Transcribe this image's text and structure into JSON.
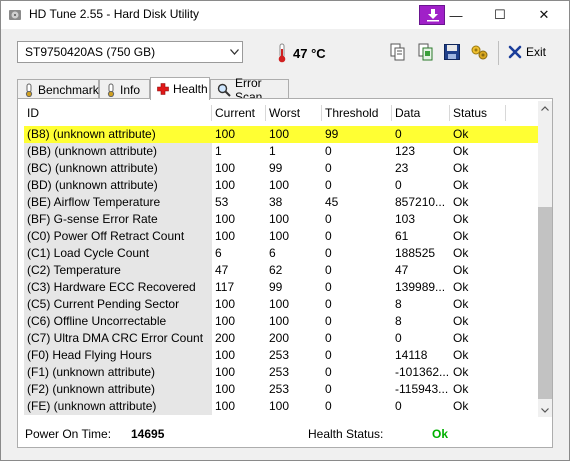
{
  "window": {
    "title": "HD Tune 2.55 - Hard Disk Utility",
    "minimize": "—",
    "maximize": "☐",
    "close": "✕"
  },
  "toolbar": {
    "drive": "ST9750420AS (750 GB)",
    "temperature": "47 °C",
    "exit_label": "Exit"
  },
  "tabs": [
    {
      "label": "Benchmark",
      "icon": "benchmark-icon"
    },
    {
      "label": "Info",
      "icon": "info-icon"
    },
    {
      "label": "Health",
      "icon": "health-icon",
      "active": true
    },
    {
      "label": "Error Scan",
      "icon": "error-scan-icon"
    }
  ],
  "table": {
    "columns": [
      "ID",
      "Current",
      "Worst",
      "Threshold",
      "Data",
      "Status"
    ],
    "rows": [
      [
        "(B8) (unknown attribute)",
        "100",
        "100",
        "99",
        "0",
        "Ok"
      ],
      [
        "(BB) (unknown attribute)",
        "1",
        "1",
        "0",
        "123",
        "Ok"
      ],
      [
        "(BC) (unknown attribute)",
        "100",
        "99",
        "0",
        "23",
        "Ok"
      ],
      [
        "(BD) (unknown attribute)",
        "100",
        "100",
        "0",
        "0",
        "Ok"
      ],
      [
        "(BE) Airflow Temperature",
        "53",
        "38",
        "45",
        "857210...",
        "Ok"
      ],
      [
        "(BF) G-sense Error Rate",
        "100",
        "100",
        "0",
        "103",
        "Ok"
      ],
      [
        "(C0) Power Off Retract Count",
        "100",
        "100",
        "0",
        "61",
        "Ok"
      ],
      [
        "(C1) Load Cycle Count",
        "6",
        "6",
        "0",
        "188525",
        "Ok"
      ],
      [
        "(C2) Temperature",
        "47",
        "62",
        "0",
        "47",
        "Ok"
      ],
      [
        "(C3) Hardware ECC Recovered",
        "117",
        "99",
        "0",
        "139989...",
        "Ok"
      ],
      [
        "(C5) Current Pending Sector",
        "100",
        "100",
        "0",
        "8",
        "Ok"
      ],
      [
        "(C6) Offline Uncorrectable",
        "100",
        "100",
        "0",
        "8",
        "Ok"
      ],
      [
        "(C7) Ultra DMA CRC Error Count",
        "200",
        "200",
        "0",
        "0",
        "Ok"
      ],
      [
        "(F0) Head Flying Hours",
        "100",
        "253",
        "0",
        "14118",
        "Ok"
      ],
      [
        "(F1) (unknown attribute)",
        "100",
        "253",
        "0",
        "-101362...",
        "Ok"
      ],
      [
        "(F2) (unknown attribute)",
        "100",
        "253",
        "0",
        "-115943...",
        "Ok"
      ],
      [
        "(FE) (unknown attribute)",
        "100",
        "100",
        "0",
        "0",
        "Ok"
      ]
    ],
    "highlighted_row": 0
  },
  "footer": {
    "power_on_label": "Power On Time:",
    "power_on_value": "14695",
    "health_label": "Health Status:",
    "health_value": "Ok"
  },
  "colors": {
    "highlight": "#ffff33",
    "health_ok": "#00b000",
    "temperature": "#d02020"
  }
}
